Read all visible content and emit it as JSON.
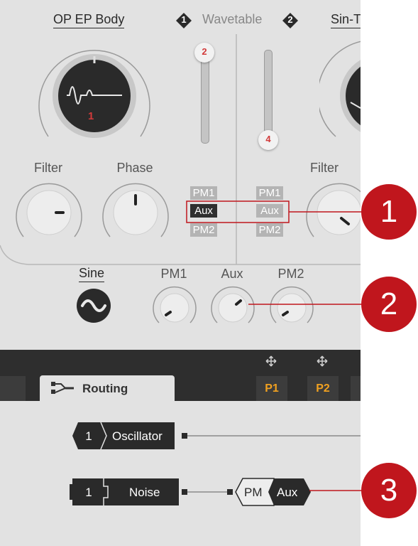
{
  "osc1": {
    "title": "OP EP Body",
    "wave_number": "1",
    "fader_badge": "2"
  },
  "osc_selector": {
    "label": "Wavetable",
    "left_badge": "1",
    "right_badge": "2"
  },
  "osc2": {
    "title": "Sin-T",
    "fader_badge": "4"
  },
  "knobs": {
    "filter": "Filter",
    "phase": "Phase",
    "filter2": "Filter"
  },
  "mod_slots_left": [
    "PM1",
    "Aux",
    "PM2"
  ],
  "mod_slots_right": [
    "PM1",
    "Aux",
    "PM2"
  ],
  "mod_section": {
    "wave": "Sine",
    "pm1": "PM1",
    "aux": "Aux",
    "pm2": "PM2"
  },
  "toolbar": {
    "routing_tab": "Routing",
    "p1": "P1",
    "p2": "P2"
  },
  "routing": {
    "oscillator_index": "1",
    "oscillator_label": "Oscillator",
    "noise_index": "1",
    "noise_label": "Noise",
    "pm_label": "PM",
    "aux_label": "Aux"
  },
  "callouts": [
    "1",
    "2",
    "3"
  ],
  "colors": {
    "panel": "#e2e2e2",
    "toolbar": "#2e2e2e",
    "callout": "#c0161d",
    "accent_orange": "#f0a020",
    "badge_red": "#d23a3a"
  }
}
